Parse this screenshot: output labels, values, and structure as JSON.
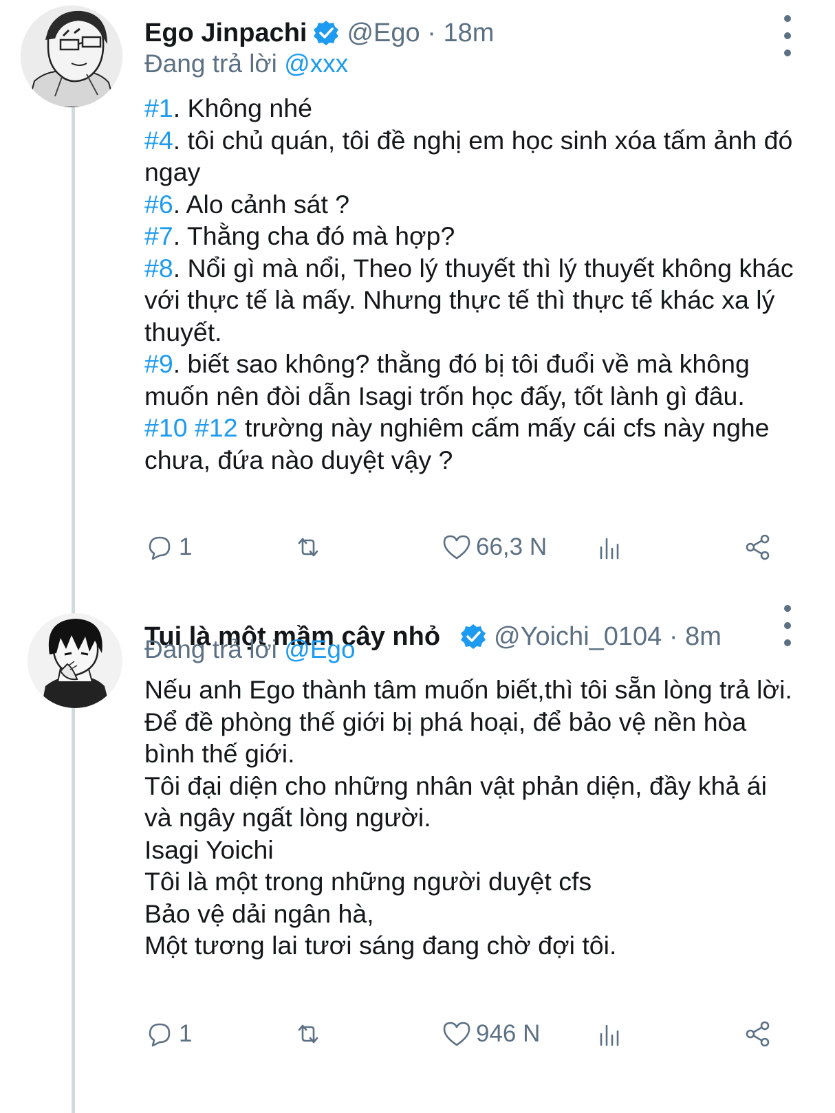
{
  "tweets": [
    {
      "display_name": "Ego Jinpachi",
      "handle_time": "@Ego · 18m",
      "reply_prefix": "Đang trả lời ",
      "reply_mention": "@xxx",
      "lines": [
        {
          "tag": "#1",
          "text": ". Không nhé"
        },
        {
          "tag": "#4",
          "text": ". tôi chủ quán, tôi đề nghị em học sinh xóa tấm ảnh đó ngay"
        },
        {
          "tag": "#6",
          "text": ". Alo cảnh sát ?"
        },
        {
          "tag": "#7",
          "text": ". Thằng cha đó mà hợp?"
        },
        {
          "tag": "#8",
          "text": ". Nổi gì mà nổi, Theo lý thuyết thì lý thuyết không khác với thực tế là mấy. Nhưng thực tế thì thực tế khác xa lý thuyết."
        },
        {
          "tag": "#9",
          "text": ". biết sao không? thằng đó bị tôi đuổi về mà không muốn nên đòi dẫn Isagi trốn học đấy, tốt lành gì đâu."
        },
        {
          "tag": "#10 #12",
          "text": " trường này nghiêm cấm mấy cái cfs này nghe chưa, đứa nào duyệt vậy ?"
        }
      ],
      "reply_count": "1",
      "like_count": "66,3 N"
    },
    {
      "display_name": "Tui là một mầm cây nhỏ",
      "handle_time": "@Yoichi_0104 · 8m",
      "reply_prefix": "Đang trả lời ",
      "reply_mention": "@Ego",
      "lines": [
        {
          "tag": "",
          "text": "Nếu anh Ego thành tâm muốn biết,thì tôi sẵn lòng trả lời."
        },
        {
          "tag": "",
          "text": "Để đề phòng thế giới bị phá hoại, để bảo vệ nền hòa bình thế giới."
        },
        {
          "tag": "",
          "text": "Tôi đại diện cho những nhân vật phản diện, đầy khả ái và ngây ngất lòng người."
        },
        {
          "tag": "",
          "text": "Isagi Yoichi"
        },
        {
          "tag": "",
          "text": "Tôi là một trong những người duyệt cfs"
        },
        {
          "tag": "",
          "text": "Bảo vệ dải ngân hà,"
        },
        {
          "tag": "",
          "text": "Một tương lai tươi sáng đang chờ đợi tôi."
        }
      ],
      "reply_count": "1",
      "like_count": "946 N"
    }
  ],
  "colors": {
    "accent": "#1d9bf0",
    "secondary_text": "#5b7083",
    "primary_text": "#14171a",
    "thread_line": "#cfd9de"
  },
  "icons": {
    "verified": "verified-badge-icon",
    "more": "more-vertical-icon",
    "reply": "reply-bubble-icon",
    "retweet": "retweet-icon",
    "like": "heart-icon",
    "views": "views-bar-chart-icon",
    "share": "share-icon"
  }
}
